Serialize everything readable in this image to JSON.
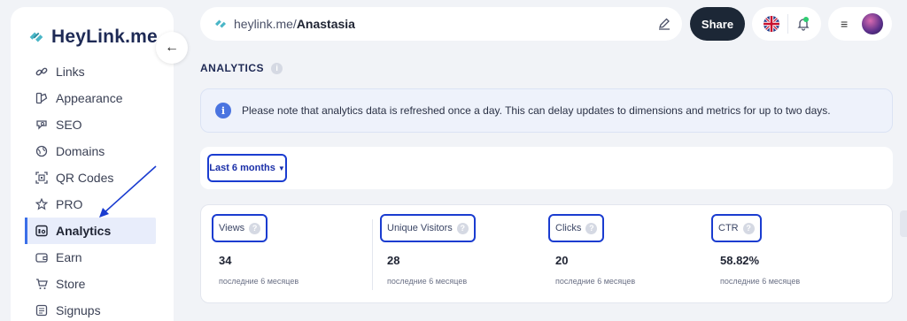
{
  "brand": {
    "name": "HeyLink.me",
    "accent": "#1a3cd0",
    "logo_color": "#4ab6c7"
  },
  "sidebar": {
    "collapse_icon": "arrow-left-icon",
    "items": [
      {
        "label": "Links",
        "icon": "link-icon",
        "active": false
      },
      {
        "label": "Appearance",
        "icon": "palette-icon",
        "active": false
      },
      {
        "label": "SEO",
        "icon": "seo-search-icon",
        "active": false
      },
      {
        "label": "Domains",
        "icon": "globe-icon",
        "active": false
      },
      {
        "label": "QR Codes",
        "icon": "qr-code-icon",
        "active": false
      },
      {
        "label": "PRO",
        "icon": "star-icon",
        "active": false
      },
      {
        "label": "Analytics",
        "icon": "analytics-icon",
        "active": true
      },
      {
        "label": "Earn",
        "icon": "wallet-icon",
        "active": false
      },
      {
        "label": "Store",
        "icon": "cart-icon",
        "active": false
      },
      {
        "label": "Signups",
        "icon": "list-icon",
        "active": false
      }
    ]
  },
  "topbar": {
    "url_domain": "heylink.me/",
    "url_user": "Anastasia",
    "share_label": "Share",
    "edit_icon": "pencil-icon",
    "language_icon": "uk-flag-icon",
    "bell_icon": "bell-icon",
    "menu_icon": "hamburger-icon",
    "notification_dot_color": "#2ecc71"
  },
  "analytics": {
    "title": "ANALYTICS",
    "notice": "Please note that analytics data is refreshed once a day. This can delay updates to dimensions and metrics for up to two days.",
    "period": "Last 6 months",
    "stats": [
      {
        "label": "Views",
        "value": "34",
        "sub": "последние 6 месяцев"
      },
      {
        "label": "Unique Visitors",
        "value": "28",
        "sub": "последние 6 месяцев"
      },
      {
        "label": "Clicks",
        "value": "20",
        "sub": "последние 6 месяцев"
      },
      {
        "label": "CTR",
        "value": "58.82%",
        "sub": "последние 6 месяцев"
      }
    ]
  }
}
